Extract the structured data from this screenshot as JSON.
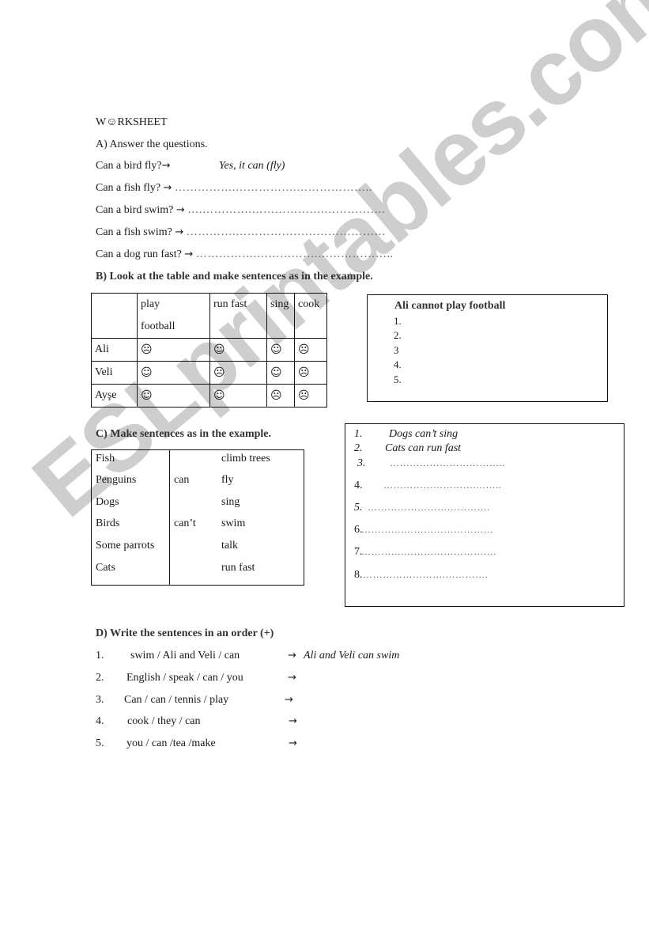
{
  "title": "W☺RKSHEET",
  "section_a": {
    "heading": "A) Answer the questions.",
    "arrow": "→",
    "items": [
      {
        "question": "Can a bird fly?",
        "answer": "Yes, it can (fly)"
      },
      {
        "question": "Can a fish fly?",
        "answer": "…………….…………….……………….."
      },
      {
        "question": "Can a bird swim?",
        "answer": "….………….……………….……………."
      },
      {
        "question": "Can a fish swim?",
        "answer": "………….…………………………………"
      },
      {
        "question": "Can a dog run fast?",
        "answer": "…………….…………….……………….."
      }
    ]
  },
  "section_b": {
    "heading": "B) Look at the table and make sentences as in the example.",
    "table": {
      "headers": [
        "",
        "play football",
        "run fast",
        "sing",
        "cook"
      ],
      "header_lines": [
        [
          "play",
          "football"
        ]
      ],
      "rows": [
        {
          "name": "Ali",
          "faces": [
            "☹",
            "☺",
            "☺",
            "☹"
          ]
        },
        {
          "name": "Veli",
          "faces": [
            "☺",
            "☹",
            "☺",
            "☹"
          ]
        },
        {
          "name": "Ayşe",
          "faces": [
            "☺",
            "☺",
            "☹",
            "☹"
          ]
        }
      ]
    },
    "answer_box": {
      "example": "Ali cannot play football",
      "lines": [
        "1.",
        "2.",
        "3",
        "4.",
        "5."
      ]
    }
  },
  "section_c": {
    "heading": "C) Make sentences as in the example.",
    "subjects": [
      "Fish",
      "Penguins",
      "Dogs",
      "Birds",
      "Some parrots",
      "Cats"
    ],
    "modals": [
      "can",
      "can’t"
    ],
    "verbs": [
      "climb trees",
      "fly",
      "sing",
      "swim",
      "talk",
      "run fast"
    ],
    "answer_box": {
      "lines": [
        {
          "num": "1.",
          "text": "Dogs can’t sing"
        },
        {
          "num": "2.",
          "text": "Cats can run fast"
        },
        {
          "num": "3.",
          "text": "…………………………….."
        },
        {
          "num": "4.",
          "text": "……………………….…….."
        },
        {
          "num": "5.",
          "text": "………………………………."
        },
        {
          "num": "6.",
          "text": "………….………………………"
        },
        {
          "num": "7.",
          "text": "………….………………………."
        },
        {
          "num": "8.",
          "text": "…………………….…………."
        }
      ]
    }
  },
  "section_d": {
    "heading": "D) Write the sentences in an order (+)",
    "arrow": "→",
    "items": [
      {
        "num": "1.",
        "words": "swim / Ali  and Veli / can",
        "answer": "Ali and Veli can swim"
      },
      {
        "num": "2.",
        "words": "English / speak / can / you",
        "answer": ""
      },
      {
        "num": "3.",
        "words": "Can / can / tennis / play",
        "answer": ""
      },
      {
        "num": "4.",
        "words": "cook / they / can",
        "answer": ""
      },
      {
        "num": "5.",
        "words": "you / can /tea /make",
        "answer": ""
      }
    ]
  },
  "watermark": "ESLprintables.com",
  "colors": {
    "watermark": "#c6c6c6",
    "text": "#1a1a1a",
    "border": "#111111"
  }
}
